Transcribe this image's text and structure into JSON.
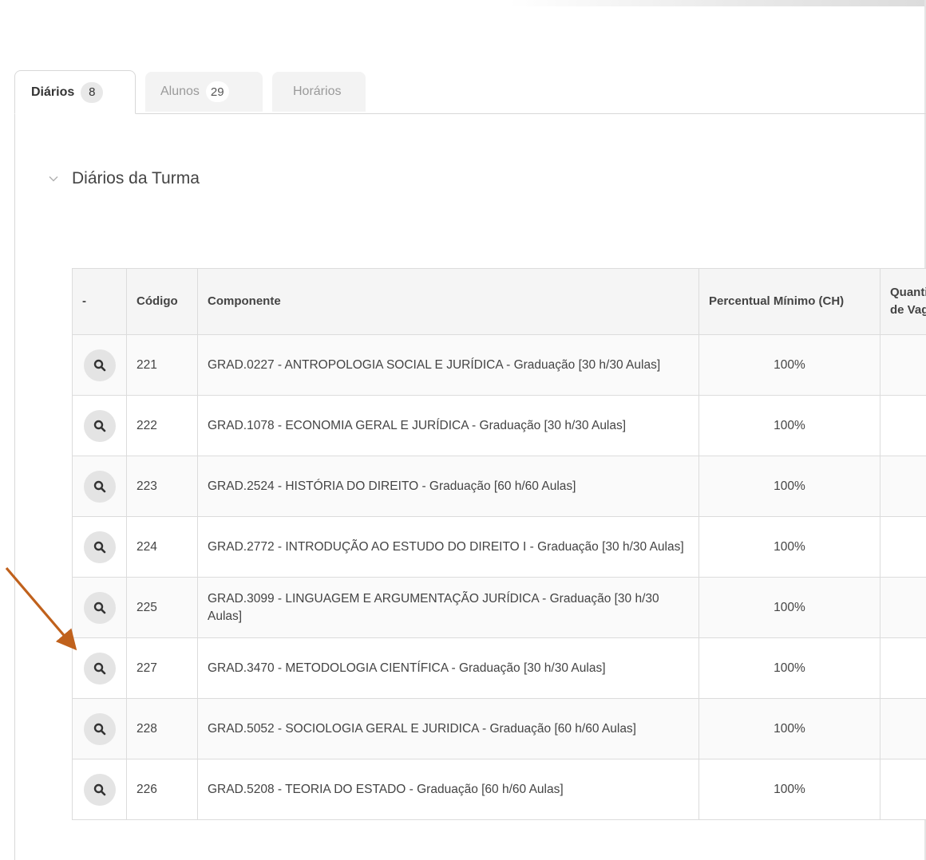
{
  "tabs": [
    {
      "label": "Diários",
      "count": "8"
    },
    {
      "label": "Alunos",
      "count": "29"
    },
    {
      "label": "Horários"
    }
  ],
  "section": {
    "title": "Diários da Turma"
  },
  "table": {
    "headers": {
      "action": "-",
      "code": "Código",
      "component": "Componente",
      "percent": "Percentual Mínimo (CH)",
      "quantity": "Quantidade de Vagas"
    },
    "rows": [
      {
        "code": "221",
        "component": "GRAD.0227 - ANTROPOLOGIA SOCIAL E JURÍDICA - Graduação [30 h/30 Aulas]",
        "percent": "100%"
      },
      {
        "code": "222",
        "component": "GRAD.1078 - ECONOMIA GERAL E JURÍDICA - Graduação [30 h/30 Aulas]",
        "percent": "100%"
      },
      {
        "code": "223",
        "component": "GRAD.2524 - HISTÓRIA DO DIREITO - Graduação [60 h/60 Aulas]",
        "percent": "100%"
      },
      {
        "code": "224",
        "component": "GRAD.2772 - INTRODUÇÃO AO ESTUDO DO DIREITO I - Graduação [30 h/30 Aulas]",
        "percent": "100%"
      },
      {
        "code": "225",
        "component": "GRAD.3099 - LINGUAGEM E ARGUMENTAÇÃO JURÍDICA - Graduação [30 h/30 Aulas]",
        "percent": "100%"
      },
      {
        "code": "227",
        "component": "GRAD.3470 - METODOLOGIA CIENTÍFICA - Graduação [30 h/30 Aulas]",
        "percent": "100%"
      },
      {
        "code": "228",
        "component": "GRAD.5052 - SOCIOLOGIA GERAL E JURIDICA - Graduação [60 h/60 Aulas]",
        "percent": "100%"
      },
      {
        "code": "226",
        "component": "GRAD.5208 - TEORIA DO ESTADO - Graduação [60 h/60 Aulas]",
        "percent": "100%"
      }
    ]
  },
  "icons": {
    "row_action": "search-icon",
    "section_toggle": "chevron-down-icon"
  },
  "colors": {
    "annotation_arrow": "#c0611c"
  }
}
